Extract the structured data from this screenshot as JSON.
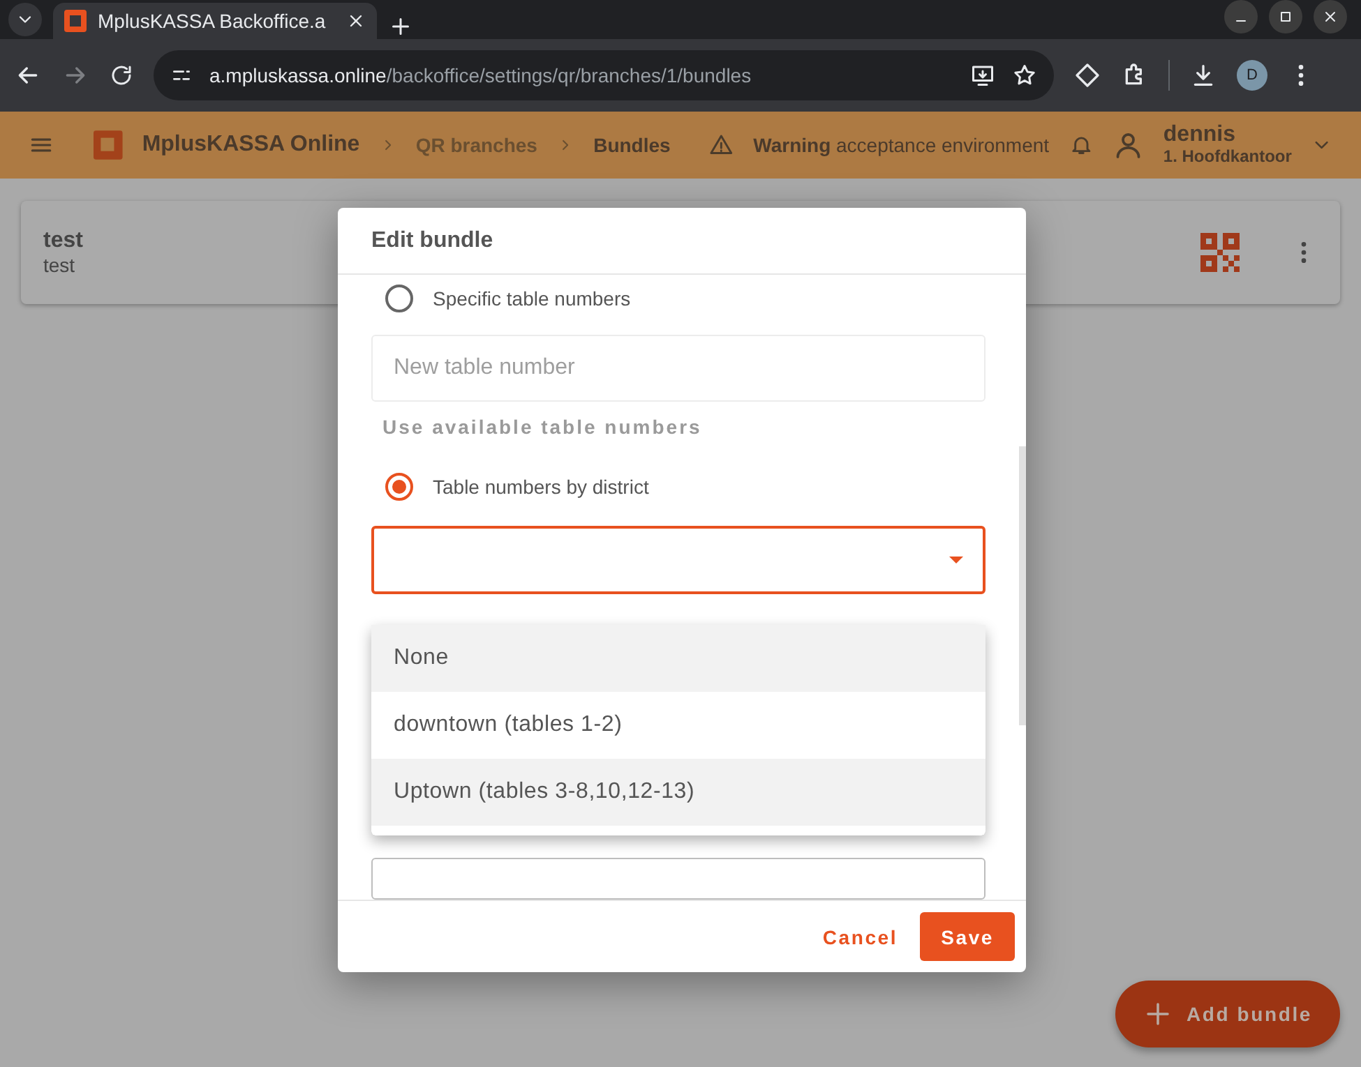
{
  "browser": {
    "tab_title": "MplusKASSA Backoffice.a",
    "url_host": "a.mpluskassa.online",
    "url_path": "/backoffice/settings/qr/branches/1/bundles",
    "profile_letter": "D"
  },
  "header": {
    "app_name": "MplusKASSA Online",
    "breadcrumbs": [
      "QR branches",
      "Bundles"
    ],
    "warning": "**Warning** acceptance environment",
    "user_name": "dennis",
    "user_branch": "1. Hoofdkantoor"
  },
  "card": {
    "title": "test",
    "subtitle": "test"
  },
  "dialog": {
    "title": "Edit bundle",
    "specific_option": {
      "label": "Specific table numbers",
      "selected": false
    },
    "table_number_field": {
      "placeholder": "New table number"
    },
    "section_label": "Use available table numbers",
    "district_option": {
      "label": "Table numbers by district",
      "selected": true
    },
    "district_menu": [
      {
        "label": "None",
        "highlighted": true
      },
      {
        "label": "downtown (tables 1-2)",
        "highlighted": false
      },
      {
        "label": "Uptown (tables 3-8,10,12-13)",
        "highlighted": true
      }
    ],
    "buttons": {
      "cancel": "Cancel",
      "save": "Save"
    }
  },
  "fab": {
    "label": "Add bundle"
  }
}
